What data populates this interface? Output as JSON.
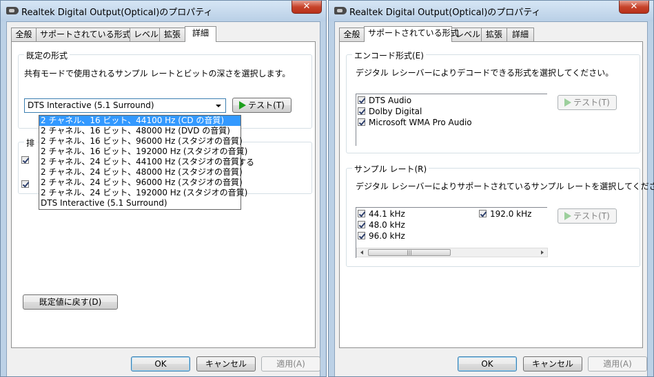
{
  "left_window": {
    "title": "Realtek Digital Output(Optical)のプロパティ",
    "close_glyph": "✕",
    "tabs": [
      "全般",
      "サポートされている形式",
      "レベル",
      "拡張",
      "詳細"
    ],
    "active_tab": "詳細",
    "default_format": {
      "group_label": "既定の形式",
      "description": "共有モードで使用されるサンプル レートとビットの深さを選択します。",
      "selected_value": "DTS Interactive (5.1 Surround)",
      "test_button": "テスト(T)",
      "options": [
        "2 チャネル、16 ビット、44100 Hz (CD の音質)",
        "2 チャネル、16 ビット、48000 Hz (DVD の音質)",
        "2 チャネル、16 ビット、96000 Hz (スタジオの音質)",
        "2 チャネル、16 ビット、192000 Hz (スタジオの音質)",
        "2 チャネル、24 ビット、44100 Hz (スタジオの音質)",
        "2 チャネル、24 ビット、48000 Hz (スタジオの音質)",
        "2 チャネル、24 ビット、96000 Hz (スタジオの音質)",
        "2 チャネル、24 ビット、192000 Hz (スタジオの音質)",
        "DTS Interactive (5.1 Surround)"
      ],
      "highlighted_option": "2 チャネル、16 ビット、44100 Hz (CD の音質)"
    },
    "exclusive_mode": {
      "group_label_partial": "排",
      "text_partial": "する"
    },
    "restore_defaults_button": "既定値に戻す(D)",
    "ok_button": "OK",
    "cancel_button": "キャンセル",
    "apply_button": "適用(A)"
  },
  "right_window": {
    "title": "Realtek Digital Output(Optical)のプロパティ",
    "close_glyph": "✕",
    "tabs": [
      "全般",
      "サポートされている形式",
      "レベル",
      "拡張",
      "詳細"
    ],
    "active_tab": "サポートされている形式",
    "encoded_formats": {
      "group_label": "エンコード形式(E)",
      "description": "デジタル レシーバーによりデコードできる形式を選択してください。",
      "items": [
        {
          "label": "DTS Audio",
          "checked": true
        },
        {
          "label": "Dolby Digital",
          "checked": true
        },
        {
          "label": "Microsoft WMA Pro Audio",
          "checked": true
        }
      ],
      "test_button": "テスト(T)"
    },
    "sample_rates": {
      "group_label": "サンプル レート(R)",
      "description": "デジタル レシーバーによりサポートされているサンプル レートを選択してください。",
      "items": [
        {
          "label": "44.1 kHz",
          "checked": true
        },
        {
          "label": "48.0 kHz",
          "checked": true
        },
        {
          "label": "96.0 kHz",
          "checked": true
        },
        {
          "label": "192.0 kHz",
          "checked": true
        }
      ],
      "scroll_thumb_glyph": "|||",
      "test_button": "テスト(T)"
    },
    "ok_button": "OK",
    "cancel_button": "キャンセル",
    "apply_button": "適用(A)"
  }
}
